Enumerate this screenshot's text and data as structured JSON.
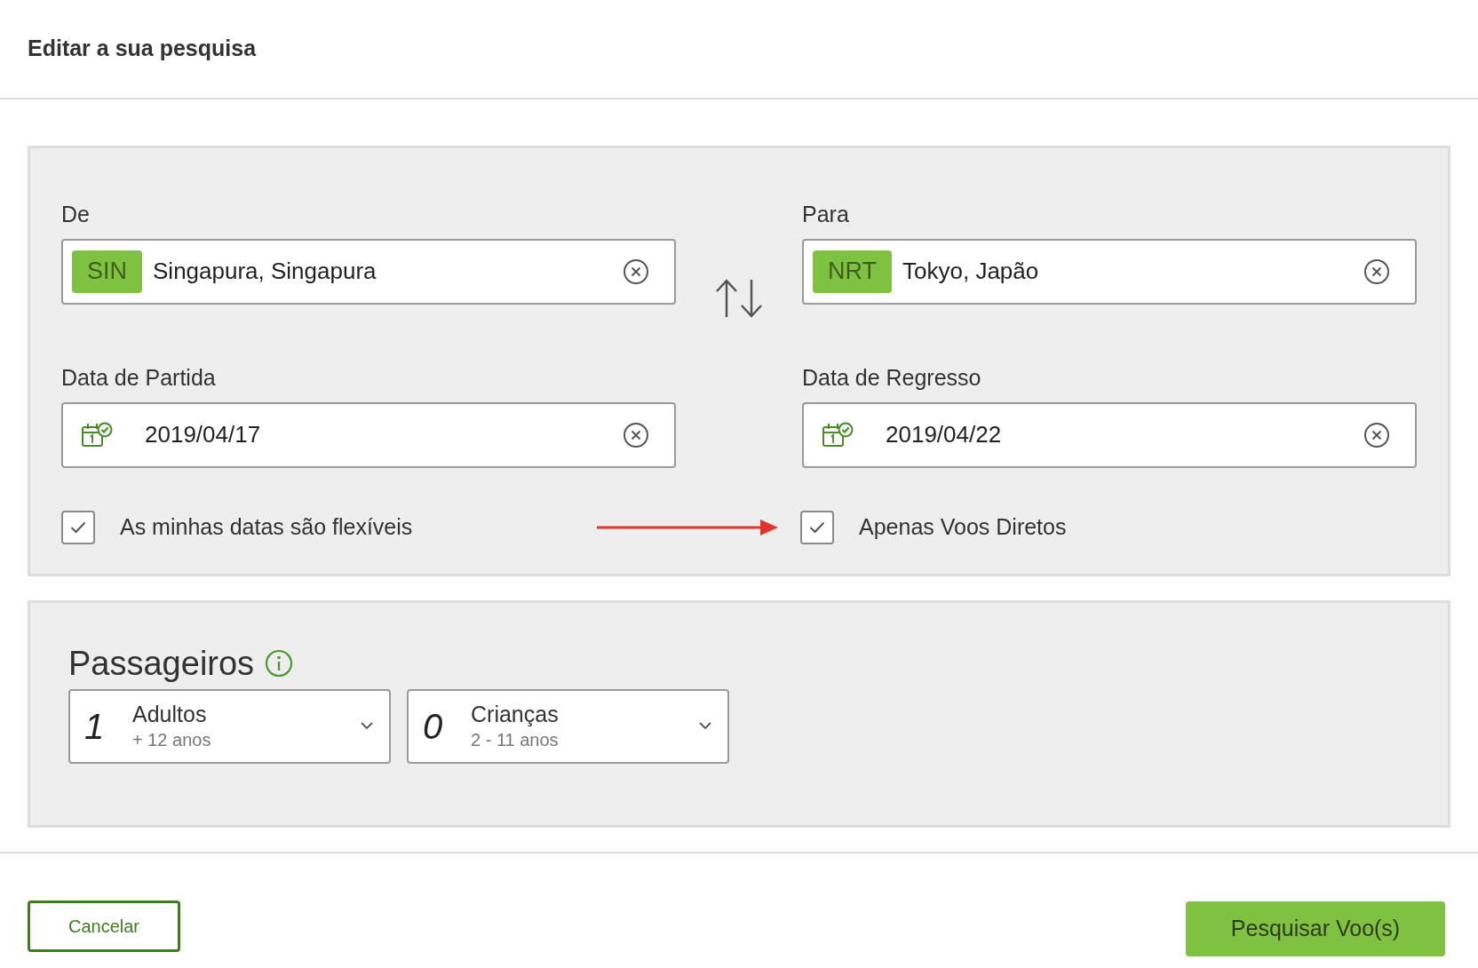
{
  "title": "Editar a sua pesquisa",
  "route": [
    {
      "label": "De",
      "code": "SIN",
      "value": "Singapura, Singapura"
    },
    {
      "label": "Para",
      "code": "NRT",
      "value": "Tokyo, Japão"
    }
  ],
  "dates": [
    {
      "label": "Data de Partida",
      "value": "2019/04/17"
    },
    {
      "label": "Data de Regresso",
      "value": "2019/04/22"
    }
  ],
  "options": [
    {
      "label": "As minhas datas são flexíveis",
      "checked": true
    },
    {
      "label": "Apenas Voos Diretos",
      "checked": true
    }
  ],
  "passengers": {
    "title": "Passageiros",
    "groups": [
      {
        "count": "1",
        "label": "Adultos",
        "ages": "+ 12 anos"
      },
      {
        "count": "0",
        "label": "Crianças",
        "ages": "2 - 11 anos"
      }
    ]
  },
  "buttons": {
    "cancel": "Cancelar",
    "search": "Pesquisar Voo(s)"
  }
}
